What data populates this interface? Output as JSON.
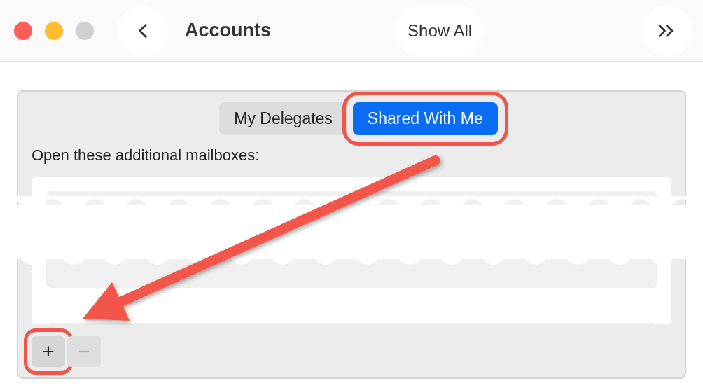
{
  "toolbar": {
    "title": "Accounts",
    "show_all": "Show All"
  },
  "tabs": [
    {
      "label": "My Delegates",
      "selected": false,
      "highlighted": false
    },
    {
      "label": "Shared With Me",
      "selected": true,
      "highlighted": true
    }
  ],
  "mailboxes_label": "Open these additional mailboxes:",
  "buttons": [
    {
      "label": "+",
      "disabled": false,
      "highlighted": true
    },
    {
      "label": "−",
      "disabled": true,
      "highlighted": false
    }
  ]
}
